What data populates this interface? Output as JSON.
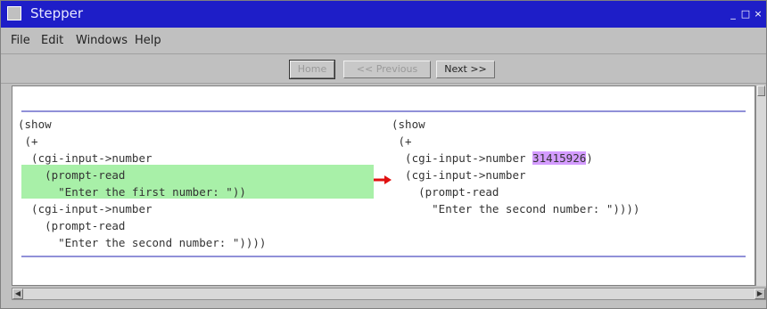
{
  "window": {
    "title": "Stepper",
    "minimize_glyph": "_",
    "maximize_glyph": "□",
    "close_glyph": "×"
  },
  "menu": {
    "items": [
      "File",
      "Edit",
      "Windows",
      "Help"
    ]
  },
  "toolbar": {
    "home_label": "Home",
    "previous_label": "<< Previous",
    "next_label": "Next >>"
  },
  "left_pane": {
    "lines": [
      "(show",
      " (+",
      "  (cgi-input->number",
      "    (prompt-read",
      "      \"Enter the first number: \"))",
      "  (cgi-input->number",
      "    (prompt-read",
      "      \"Enter the second number: \"))))"
    ]
  },
  "right_pane": {
    "line_0": "(show",
    "line_1": " (+",
    "line_2_prefix": "  (cgi-input->number ",
    "line_2_value": "31415926",
    "line_2_suffix": ")",
    "line_3": "  (cgi-input->number",
    "line_4": "    (prompt-read",
    "line_5": "      \"Enter the second number: \"))))"
  },
  "colors": {
    "titlebar": "#1e1ec8",
    "redex_highlight": "#a8f0a8",
    "result_highlight": "#d49cff",
    "step_arrow": "#e01010",
    "divider": "#9090d8"
  },
  "icons": {
    "step_arrow": "right-arrow-icon",
    "scroll_left": "scroll-left-arrow-icon",
    "scroll_right": "scroll-right-arrow-icon"
  }
}
